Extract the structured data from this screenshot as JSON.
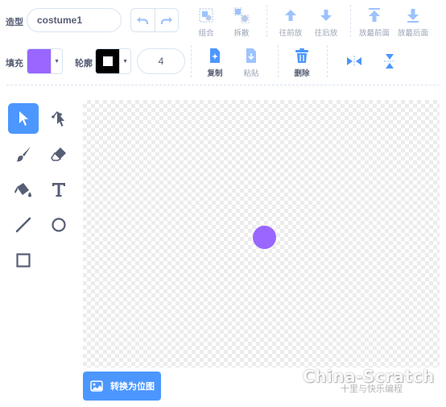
{
  "row1": {
    "costume_label": "造型",
    "costume_name": "costume1",
    "group_label": "组合",
    "ungroup_label": "拆散",
    "forward_label": "往前放",
    "backward_label": "往后放",
    "front_label": "放最前面",
    "back_label": "放最后面"
  },
  "row2": {
    "fill_label": "填充",
    "fill_color": "#9966ff",
    "outline_label": "轮廓",
    "outline_color": "#000000",
    "outline_size": "4",
    "copy_label": "复制",
    "paste_label": "粘贴",
    "delete_label": "删除"
  },
  "tools": [
    "select-icon",
    "reshape-icon",
    "brush-icon",
    "eraser-icon",
    "fill-icon",
    "text-icon",
    "line-icon",
    "circle-icon",
    "rectangle-icon"
  ],
  "canvas": {
    "shape_color": "#9966ff"
  },
  "convert_button": "转换为位图",
  "watermark": {
    "main": "China-Scratch",
    "sub": "十里与快乐编程"
  },
  "colors": {
    "accent": "#4c97ff",
    "text": "#575e75"
  }
}
